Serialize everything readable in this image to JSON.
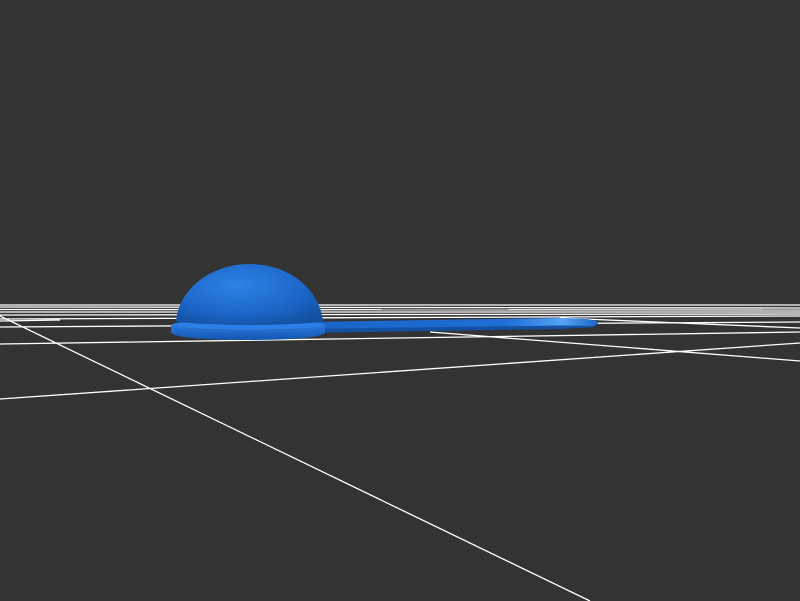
{
  "viewer": {
    "background_color": "#333333",
    "grid_color": "#ffffff",
    "model_color": "#1f6fd6",
    "model_highlight_color": "#4a9bf0",
    "model_shadow_color": "#0d3f8a"
  },
  "model": {
    "parts": [
      "dome",
      "base-disc",
      "flat-tab"
    ]
  }
}
